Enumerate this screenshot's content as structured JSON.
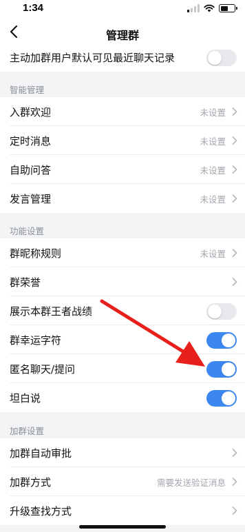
{
  "status_bar": {
    "time": "1:34"
  },
  "nav": {
    "title": "管理群"
  },
  "top_row": {
    "label": "主动加群用户默认可见最近聊天记录",
    "toggle_on": false
  },
  "sections": [
    {
      "title": "智能管理",
      "rows": [
        {
          "label": "入群欢迎",
          "value": "未设置",
          "control": "chevron"
        },
        {
          "label": "定时消息",
          "value": "未设置",
          "control": "chevron"
        },
        {
          "label": "自助问答",
          "value": "未设置",
          "control": "chevron"
        },
        {
          "label": "发言管理",
          "value": "未设置",
          "control": "chevron"
        }
      ]
    },
    {
      "title": "功能设置",
      "rows": [
        {
          "label": "群昵称规则",
          "value": "未设置",
          "control": "chevron"
        },
        {
          "label": "群荣誉",
          "value": "",
          "control": "chevron"
        },
        {
          "label": "展示本群王者战绩",
          "control": "toggle",
          "on": false
        },
        {
          "label": "群幸运字符",
          "control": "toggle",
          "on": true
        },
        {
          "label": "匿名聊天/提问",
          "control": "toggle",
          "on": true
        },
        {
          "label": "坦白说",
          "control": "toggle",
          "on": true
        }
      ]
    },
    {
      "title": "加群设置",
      "rows": [
        {
          "label": "加群自动审批",
          "value": "",
          "control": "chevron"
        },
        {
          "label": "加群方式",
          "value": "需要发送验证消息",
          "control": "chevron"
        },
        {
          "label": "升级查找方式",
          "value": "",
          "control": "chevron"
        }
      ]
    }
  ],
  "colors": {
    "toggle_on": "#3c86f0",
    "toggle_off": "#e8e9ec",
    "annotation_arrow": "#e8201c"
  },
  "icons": {
    "back": "chevron-left-icon",
    "row_disclosure": "chevron-right-icon"
  }
}
